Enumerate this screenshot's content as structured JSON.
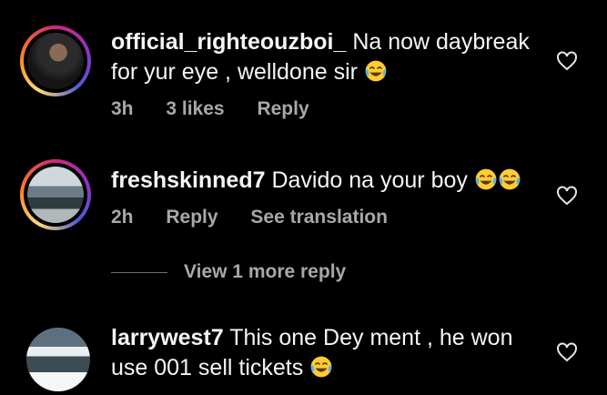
{
  "comments": [
    {
      "username": "official_righteouzboi_",
      "text": "Na now daybreak for yur eye , welldone sir",
      "emojis": [
        "laughing-tears"
      ],
      "time": "3h",
      "likes": "3 likes",
      "reply": "Reply",
      "avatar_ring": true
    },
    {
      "username": "freshskinned7",
      "text": "Davido na your boy",
      "emojis": [
        "laughing-tears",
        "laughing-tears"
      ],
      "time": "2h",
      "reply": "Reply",
      "translate": "See translation",
      "avatar_ring": true
    },
    {
      "username": "larrywest7",
      "text": "This one Dey ment , he won use 001 sell tickets",
      "emojis": [
        "laughing-tears"
      ],
      "avatar_ring": false
    }
  ],
  "thread": {
    "label": "View 1 more reply"
  },
  "icons": {
    "like": "heart-icon",
    "emoji": "face-with-tears-of-joy"
  },
  "colors": {
    "background": "#000000",
    "text": "#f5f5f5",
    "muted": "#a8a8a8"
  }
}
